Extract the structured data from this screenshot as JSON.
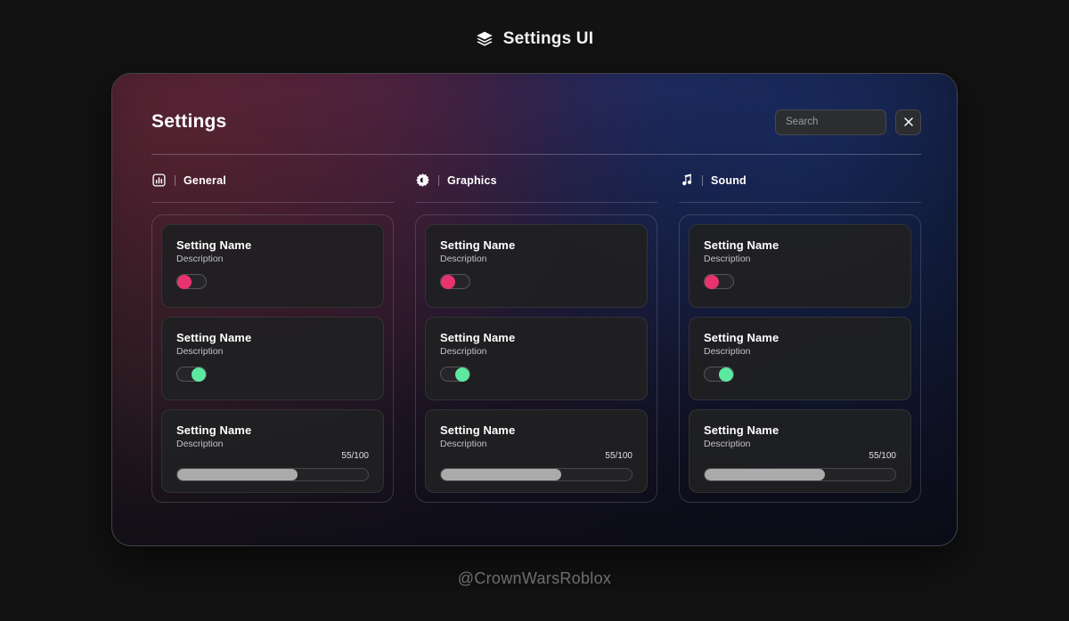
{
  "page": {
    "title": "Settings UI",
    "title_icon": "layers-icon",
    "watermark": "@CrownWarsRoblox",
    "background": "#121212"
  },
  "panel": {
    "heading": "Settings",
    "search": {
      "placeholder": "Search",
      "value": ""
    },
    "close_icon": "close-icon"
  },
  "tabs": [
    {
      "label": "General",
      "icon": "bar-chart-icon"
    },
    {
      "label": "Graphics",
      "icon": "gear-icon"
    },
    {
      "label": "Sound",
      "icon": "music-note-icon"
    }
  ],
  "cards": {
    "title": "Setting Name",
    "description": "Description",
    "slider_value": "55/100",
    "slider_percent": 63
  },
  "columns": [
    {
      "tab": "General",
      "items": [
        {
          "type": "toggle",
          "title": "Setting Name",
          "description": "Description",
          "state": "off",
          "color": "#e8336e"
        },
        {
          "type": "toggle",
          "title": "Setting Name",
          "description": "Description",
          "state": "on",
          "color": "#5de8a0"
        },
        {
          "type": "slider",
          "title": "Setting Name",
          "description": "Description",
          "value": "55/100",
          "percent": 63,
          "color": "#ababab"
        }
      ]
    },
    {
      "tab": "Graphics",
      "items": [
        {
          "type": "toggle",
          "title": "Setting Name",
          "description": "Description",
          "state": "off",
          "color": "#e8336e"
        },
        {
          "type": "toggle",
          "title": "Setting Name",
          "description": "Description",
          "state": "on",
          "color": "#5de8a0"
        },
        {
          "type": "slider",
          "title": "Setting Name",
          "description": "Description",
          "value": "55/100",
          "percent": 63,
          "color": "#ababab"
        }
      ]
    },
    {
      "tab": "Sound",
      "items": [
        {
          "type": "toggle",
          "title": "Setting Name",
          "description": "Description",
          "state": "off",
          "color": "#e8336e"
        },
        {
          "type": "toggle",
          "title": "Setting Name",
          "description": "Description",
          "state": "on",
          "color": "#5de8a0"
        },
        {
          "type": "slider",
          "title": "Setting Name",
          "description": "Description",
          "value": "55/100",
          "percent": 63,
          "color": "#ababab"
        }
      ]
    }
  ],
  "colors": {
    "toggle_off_accent": "#e8336e",
    "toggle_on_accent": "#5de8a0",
    "slider_fill": "#ababab",
    "card_bg": "#202022",
    "panel_border": "#bdb9cb"
  }
}
